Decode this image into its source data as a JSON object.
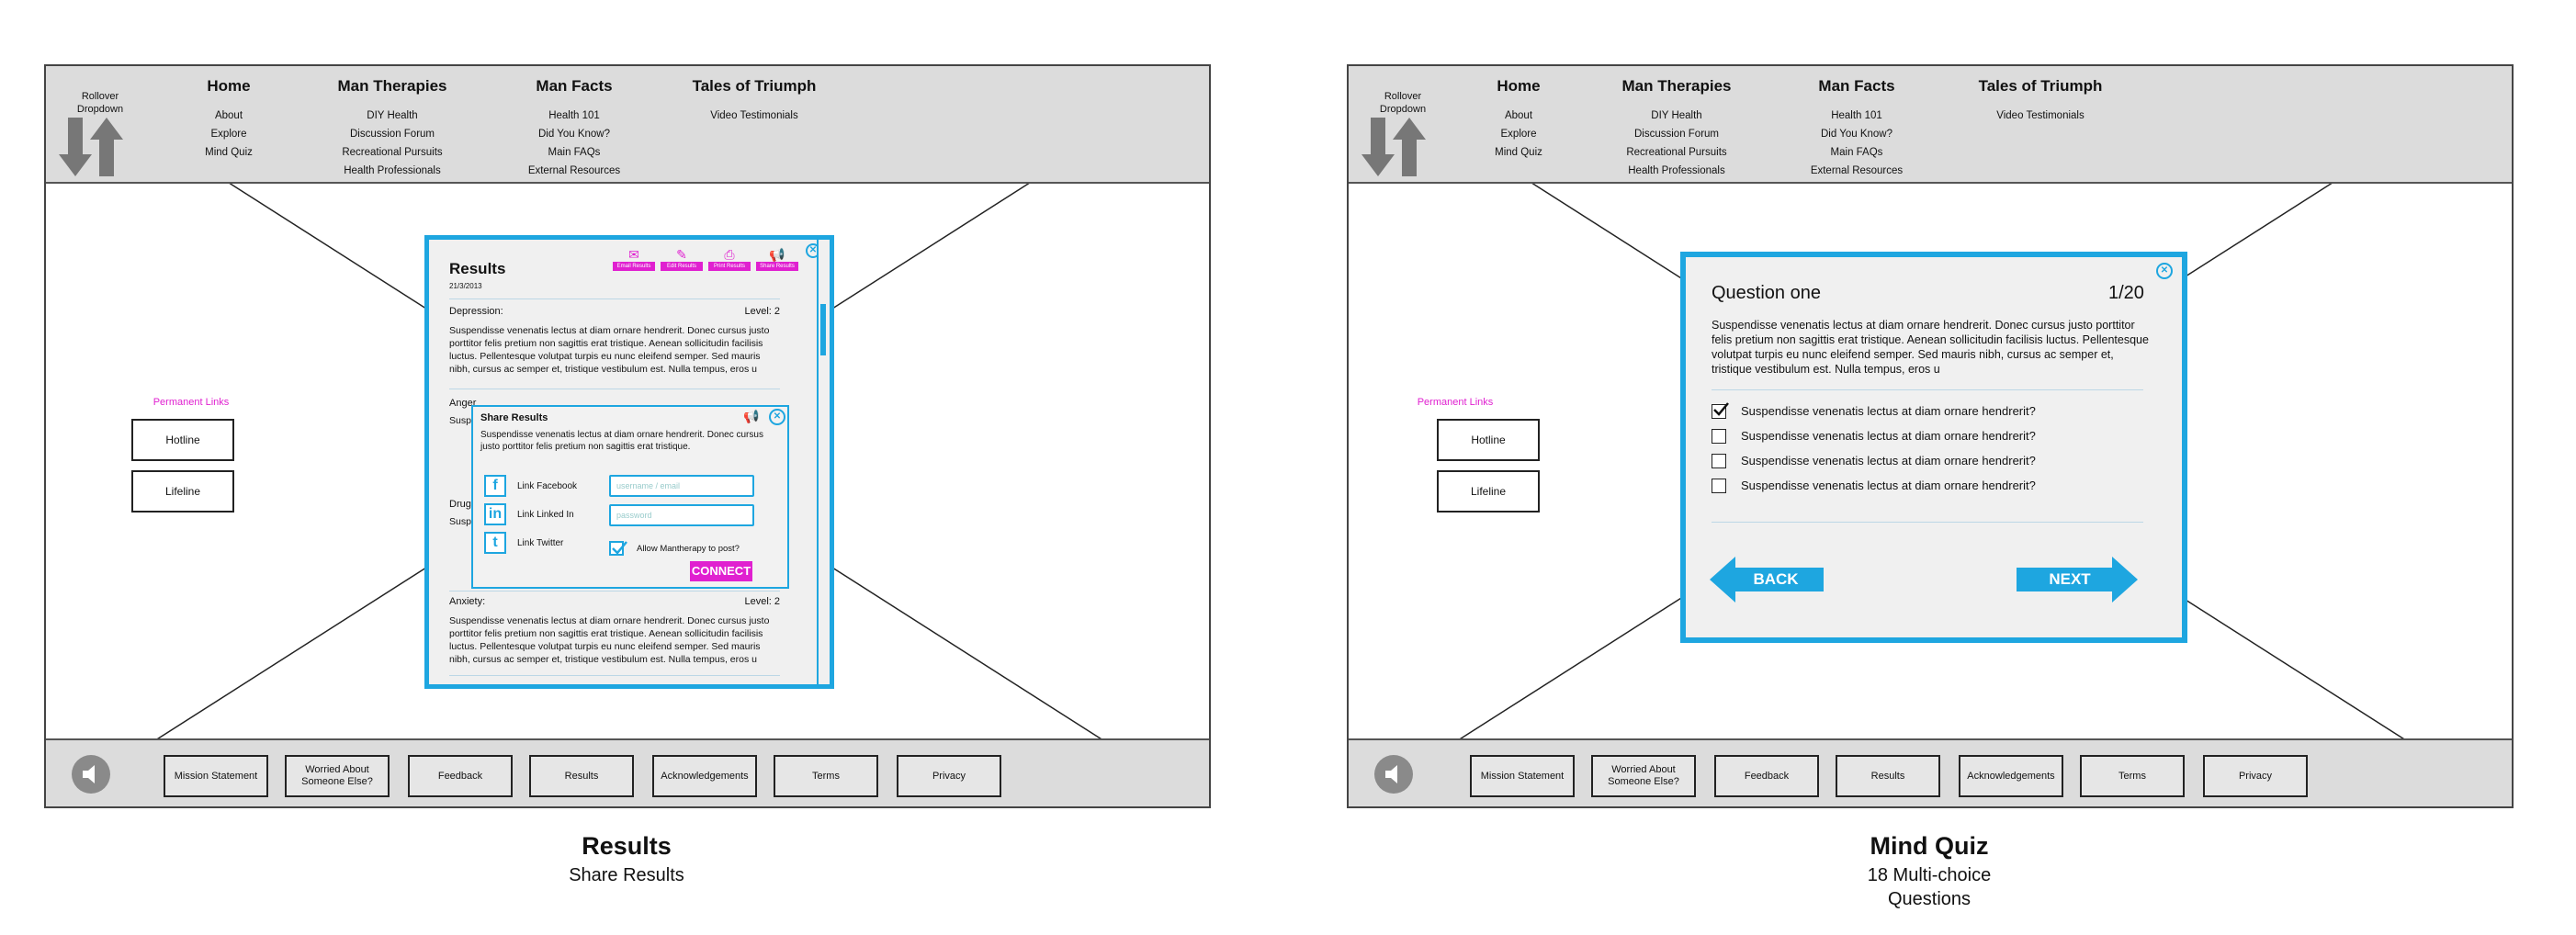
{
  "header": {
    "rollover_label": "Rollover Dropdown",
    "nav": [
      {
        "title": "Home",
        "items": [
          "About",
          "Explore",
          "Mind Quiz"
        ]
      },
      {
        "title": "Man Therapies",
        "items": [
          "DIY Health",
          "Discussion Forum",
          "Recreational Pursuits",
          "Health Professionals"
        ]
      },
      {
        "title": "Man Facts",
        "items": [
          "Health 101",
          "Did You Know?",
          "Main FAQs",
          "External Resources"
        ]
      },
      {
        "title": "Tales of Triumph",
        "items": [
          "Video Testimonials"
        ]
      }
    ]
  },
  "permanent_links": {
    "title": "Permanent Links",
    "items": [
      "Hotline",
      "Lifeline"
    ]
  },
  "footer": {
    "buttons": [
      "Mission Statement",
      "Worried About Someone Else?",
      "Feedback",
      "Results",
      "Acknowledgements",
      "Terms",
      "Privacy"
    ]
  },
  "results_modal": {
    "title": "Results",
    "date": "21/3/2013",
    "actions": [
      "Email Results",
      "Edit Results",
      "Print Results",
      "Share Results"
    ],
    "sections": [
      {
        "label": "Depression:",
        "level": "Level: 2",
        "text": "Suspendisse venenatis lectus at diam ornare hendrerit. Donec cursus justo porttitor felis pretium non sagittis erat tristique. Aenean sollicitudin facilisis luctus. Pellentesque volutpat turpis eu nunc eleifend semper. Sed mauris nibh, cursus ac semper et, tristique vestibulum est. Nulla tempus, eros u"
      },
      {
        "label": "Anger",
        "level": "",
        "text": "Susp"
      },
      {
        "label": "Drug",
        "level": "",
        "text": "Susp"
      },
      {
        "label": "Anxiety:",
        "level": "Level: 2",
        "text": "Suspendisse venenatis lectus at diam ornare hendrerit. Donec cursus justo porttitor felis pretium non sagittis erat tristique. Aenean sollicitudin facilisis luctus. Pellentesque volutpat turpis eu nunc eleifend semper. Sed mauris nibh, cursus ac semper et, tristique vestibulum est. Nulla tempus, eros u"
      }
    ],
    "share": {
      "title": "Share Results",
      "description": "Suspendisse venenatis lectus at diam ornare hendrerit. Donec cursus justo porttitor felis pretium non sagittis erat tristique.",
      "facebook_label": "Link Facebook",
      "linkedin_label": "Link Linked In",
      "twitter_label": "Link Twitter",
      "username_placeholder": "username / email",
      "password_placeholder": "password",
      "allow_label": "Allow Mantherapy to post?",
      "allow_checked": true,
      "connect_label": "CONNECT"
    }
  },
  "quiz_modal": {
    "title": "Question one",
    "counter": "1/20",
    "body": "Suspendisse venenatis lectus at diam ornare hendrerit. Donec cursus justo porttitor felis pretium non sagittis erat tristique. Aenean sollicitudin facilisis luctus. Pellentesque volutpat turpis eu nunc eleifend semper. Sed mauris nibh, cursus ac semper et, tristique vestibulum est. Nulla tempus, eros u",
    "options": [
      {
        "text": "Suspendisse venenatis lectus at diam ornare hendrerit?",
        "checked": true
      },
      {
        "text": "Suspendisse venenatis lectus at diam ornare hendrerit?",
        "checked": false
      },
      {
        "text": "Suspendisse venenatis lectus at diam ornare hendrerit?",
        "checked": false
      },
      {
        "text": "Suspendisse venenatis lectus at diam ornare hendrerit?",
        "checked": false
      }
    ],
    "back_label": "BACK",
    "next_label": "NEXT"
  },
  "captions": {
    "left_title": "Results",
    "left_sub": "Share Results",
    "right_title": "Mind Quiz",
    "right_sub_1": "18 Multi-choice",
    "right_sub_2": "Questions"
  },
  "colors": {
    "accent_blue": "#1ea6e0",
    "accent_magenta": "#e020d0",
    "chrome_gray": "#dcdcdc"
  }
}
